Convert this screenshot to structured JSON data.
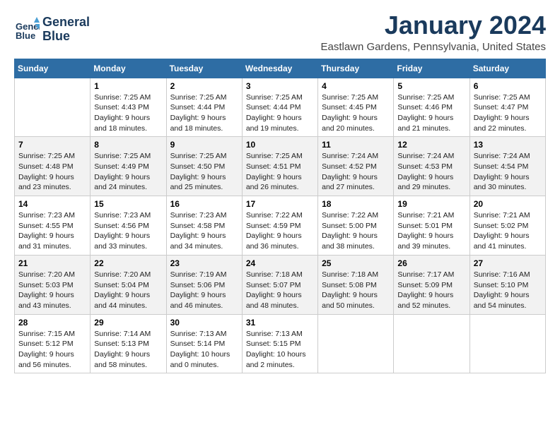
{
  "header": {
    "logo_line1": "General",
    "logo_line2": "Blue",
    "month": "January 2024",
    "location": "Eastlawn Gardens, Pennsylvania, United States"
  },
  "weekdays": [
    "Sunday",
    "Monday",
    "Tuesday",
    "Wednesday",
    "Thursday",
    "Friday",
    "Saturday"
  ],
  "weeks": [
    [
      {
        "day": "",
        "info": ""
      },
      {
        "day": "1",
        "info": "Sunrise: 7:25 AM\nSunset: 4:43 PM\nDaylight: 9 hours\nand 18 minutes."
      },
      {
        "day": "2",
        "info": "Sunrise: 7:25 AM\nSunset: 4:44 PM\nDaylight: 9 hours\nand 18 minutes."
      },
      {
        "day": "3",
        "info": "Sunrise: 7:25 AM\nSunset: 4:44 PM\nDaylight: 9 hours\nand 19 minutes."
      },
      {
        "day": "4",
        "info": "Sunrise: 7:25 AM\nSunset: 4:45 PM\nDaylight: 9 hours\nand 20 minutes."
      },
      {
        "day": "5",
        "info": "Sunrise: 7:25 AM\nSunset: 4:46 PM\nDaylight: 9 hours\nand 21 minutes."
      },
      {
        "day": "6",
        "info": "Sunrise: 7:25 AM\nSunset: 4:47 PM\nDaylight: 9 hours\nand 22 minutes."
      }
    ],
    [
      {
        "day": "7",
        "info": "Sunrise: 7:25 AM\nSunset: 4:48 PM\nDaylight: 9 hours\nand 23 minutes."
      },
      {
        "day": "8",
        "info": "Sunrise: 7:25 AM\nSunset: 4:49 PM\nDaylight: 9 hours\nand 24 minutes."
      },
      {
        "day": "9",
        "info": "Sunrise: 7:25 AM\nSunset: 4:50 PM\nDaylight: 9 hours\nand 25 minutes."
      },
      {
        "day": "10",
        "info": "Sunrise: 7:25 AM\nSunset: 4:51 PM\nDaylight: 9 hours\nand 26 minutes."
      },
      {
        "day": "11",
        "info": "Sunrise: 7:24 AM\nSunset: 4:52 PM\nDaylight: 9 hours\nand 27 minutes."
      },
      {
        "day": "12",
        "info": "Sunrise: 7:24 AM\nSunset: 4:53 PM\nDaylight: 9 hours\nand 29 minutes."
      },
      {
        "day": "13",
        "info": "Sunrise: 7:24 AM\nSunset: 4:54 PM\nDaylight: 9 hours\nand 30 minutes."
      }
    ],
    [
      {
        "day": "14",
        "info": "Sunrise: 7:23 AM\nSunset: 4:55 PM\nDaylight: 9 hours\nand 31 minutes."
      },
      {
        "day": "15",
        "info": "Sunrise: 7:23 AM\nSunset: 4:56 PM\nDaylight: 9 hours\nand 33 minutes."
      },
      {
        "day": "16",
        "info": "Sunrise: 7:23 AM\nSunset: 4:58 PM\nDaylight: 9 hours\nand 34 minutes."
      },
      {
        "day": "17",
        "info": "Sunrise: 7:22 AM\nSunset: 4:59 PM\nDaylight: 9 hours\nand 36 minutes."
      },
      {
        "day": "18",
        "info": "Sunrise: 7:22 AM\nSunset: 5:00 PM\nDaylight: 9 hours\nand 38 minutes."
      },
      {
        "day": "19",
        "info": "Sunrise: 7:21 AM\nSunset: 5:01 PM\nDaylight: 9 hours\nand 39 minutes."
      },
      {
        "day": "20",
        "info": "Sunrise: 7:21 AM\nSunset: 5:02 PM\nDaylight: 9 hours\nand 41 minutes."
      }
    ],
    [
      {
        "day": "21",
        "info": "Sunrise: 7:20 AM\nSunset: 5:03 PM\nDaylight: 9 hours\nand 43 minutes."
      },
      {
        "day": "22",
        "info": "Sunrise: 7:20 AM\nSunset: 5:04 PM\nDaylight: 9 hours\nand 44 minutes."
      },
      {
        "day": "23",
        "info": "Sunrise: 7:19 AM\nSunset: 5:06 PM\nDaylight: 9 hours\nand 46 minutes."
      },
      {
        "day": "24",
        "info": "Sunrise: 7:18 AM\nSunset: 5:07 PM\nDaylight: 9 hours\nand 48 minutes."
      },
      {
        "day": "25",
        "info": "Sunrise: 7:18 AM\nSunset: 5:08 PM\nDaylight: 9 hours\nand 50 minutes."
      },
      {
        "day": "26",
        "info": "Sunrise: 7:17 AM\nSunset: 5:09 PM\nDaylight: 9 hours\nand 52 minutes."
      },
      {
        "day": "27",
        "info": "Sunrise: 7:16 AM\nSunset: 5:10 PM\nDaylight: 9 hours\nand 54 minutes."
      }
    ],
    [
      {
        "day": "28",
        "info": "Sunrise: 7:15 AM\nSunset: 5:12 PM\nDaylight: 9 hours\nand 56 minutes."
      },
      {
        "day": "29",
        "info": "Sunrise: 7:14 AM\nSunset: 5:13 PM\nDaylight: 9 hours\nand 58 minutes."
      },
      {
        "day": "30",
        "info": "Sunrise: 7:13 AM\nSunset: 5:14 PM\nDaylight: 10 hours\nand 0 minutes."
      },
      {
        "day": "31",
        "info": "Sunrise: 7:13 AM\nSunset: 5:15 PM\nDaylight: 10 hours\nand 2 minutes."
      },
      {
        "day": "",
        "info": ""
      },
      {
        "day": "",
        "info": ""
      },
      {
        "day": "",
        "info": ""
      }
    ]
  ]
}
